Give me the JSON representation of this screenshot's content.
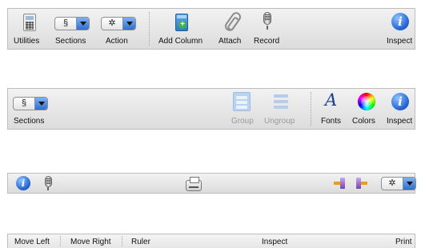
{
  "toolbar1": {
    "utilities": "Utilities",
    "sections": "Sections",
    "action": "Action",
    "add_column": "Add Column",
    "attach": "Attach",
    "record": "Record",
    "inspect": "Inspect",
    "sections_popup_glyph": "§",
    "action_popup_glyph": "✲",
    "icons": [
      "utilities-icon",
      "add-column-icon",
      "paperclip-icon",
      "microphone-icon",
      "info-icon"
    ]
  },
  "toolbar2": {
    "sections": "Sections",
    "sections_popup_glyph": "§",
    "group": "Group",
    "ungroup": "Ungroup",
    "fonts": "Fonts",
    "colors": "Colors",
    "inspect": "Inspect",
    "icons": [
      "group-icon",
      "ungroup-icon",
      "fonts-icon",
      "color-wheel-icon",
      "info-icon"
    ]
  },
  "toolbar3": {
    "action_popup_glyph": "✲",
    "icons": [
      "info-icon",
      "microphone-icon",
      "printer-icon",
      "move-right-icon",
      "move-left-icon"
    ]
  },
  "toolbar4": {
    "move_left": "Move Left",
    "move_right": "Move Right",
    "ruler": "Ruler",
    "inspect": "Inspect",
    "print": "Print"
  },
  "colors": {
    "accent_blue": "#2f6fd0",
    "toolbar_bg": "#e6e6e6",
    "disabled_text": "#9a9a9a"
  }
}
